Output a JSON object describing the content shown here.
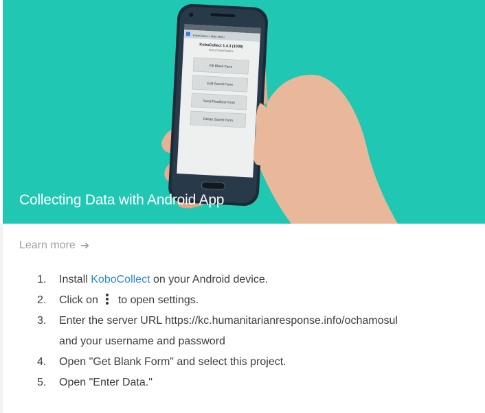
{
  "hero": {
    "title": "Collecting Data with Android App",
    "background_color": "#20c7b3",
    "phone_screen": {
      "app_header": "KoboCollect > Main Menu",
      "app_title": "KoboCollect 1.4.3 (1039)",
      "app_subtitle": "Part of KoboToolbox",
      "menu_buttons": [
        "Fill Blank Form",
        "Edit Saved Form",
        "Send Finalized Form",
        "Delete Saved Form"
      ]
    }
  },
  "learn_more": {
    "label": "Learn more",
    "icon": "arrow-right-icon"
  },
  "steps": {
    "s1": {
      "num": "1.",
      "before": "Install ",
      "link": "KoboCollect",
      "after": " on your Android device."
    },
    "s2": {
      "num": "2.",
      "before": "Click on",
      "icon": "kebab-menu-icon",
      "after": "to open settings."
    },
    "s3": {
      "num": "3.",
      "line1": "Enter the server URL https://kc.humanitarianresponse.info/ochamosul",
      "line2": "and your username and password"
    },
    "s4": {
      "num": "4.",
      "text": "Open \"Get Blank Form\" and select this project."
    },
    "s5": {
      "num": "5.",
      "text": "Open \"Enter Data.\""
    }
  },
  "colors": {
    "link": "#2f86d5",
    "muted": "#9aa0a6",
    "text": "#3c3c3c"
  }
}
